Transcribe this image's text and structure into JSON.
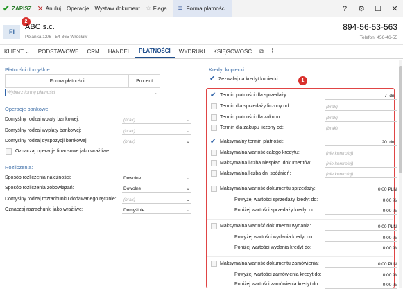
{
  "toolbar": {
    "save": "ZAPISZ",
    "cancel": "Anuluj",
    "operations": "Operacje",
    "issue_document": "Wystaw dokument",
    "flag": "Flaga",
    "active_tab": "Forma płatności",
    "icons": [
      "question-icon",
      "settings-icon",
      "maximize-icon",
      "close-icon"
    ]
  },
  "badges": {
    "one": "1",
    "two": "2"
  },
  "header": {
    "initials": "FI",
    "company": "ABC s.c.",
    "address": "Polanka 12/6 , 54-365 Wrocław",
    "nip": "894-56-53-563",
    "phone": "Telefon: 456-46-55"
  },
  "tabs": [
    "KLIENT ⌄",
    "PODSTAWOWE",
    "CRM",
    "HANDEL",
    "PŁATNOŚCI",
    "WYDRUKI",
    "KSIĘGOWOŚĆ"
  ],
  "left": {
    "payments_title": "Płatności domyślne:",
    "col_form": "Forma płatności",
    "col_percent": "Procent",
    "form_placeholder": "Wybierz formę płatności",
    "bank_title": "Operacje bankowe:",
    "bank_rows": [
      {
        "label": "Domyślny rodzaj wpłaty bankowej:",
        "value": "(brak)"
      },
      {
        "label": "Domyślny rodzaj wypłaty bankowej:",
        "value": "(brak)"
      },
      {
        "label": "Domyślny rodzaj dyspozycji bankowej:",
        "value": "(brak)"
      }
    ],
    "sensitive_label": "Oznaczaj operacje finansowe jako wrażliwe",
    "settle_title": "Rozliczenia:",
    "settle_rows": [
      {
        "label": "Sposób rozliczenia należności:",
        "value": "Dowolne"
      },
      {
        "label": "Sposób rozliczenia zobowiązań:",
        "value": "Dowolne"
      },
      {
        "label": "Domyślny rodzaj rozrachunku dodawanego ręcznie:",
        "value": "(brak)"
      },
      {
        "label": "Oznaczaj rozrachunki jako wrażliwe:",
        "value": "Domyślnie"
      }
    ]
  },
  "right": {
    "credit_title": "Kredyt kupiecki:",
    "allow_credit": "Zezwalaj na kredyt kupiecki",
    "rows": [
      {
        "label": "Termin płatności dla sprzedaży:",
        "value": "7",
        "unit": "dni",
        "checked": true
      },
      {
        "label": "Termin dla sprzedaży liczony od:",
        "value": "(brak)",
        "checked": false
      },
      {
        "label": "Termin płatności dla zakupu:",
        "value": "(brak)",
        "checked": false
      },
      {
        "label": "Termin dla zakupu liczony od:",
        "value": "(brak)",
        "checked": false
      },
      {
        "label": "Maksymalny termin płatności:",
        "value": "20",
        "unit": "dni",
        "checked": true
      },
      {
        "label": "Maksymalna wartość całego kredytu:",
        "value": "(nie kontroluj)",
        "checked": false
      },
      {
        "label": "Maksymalna liczba niespłac. dokumentów:",
        "value": "(nie kontroluj)",
        "checked": false
      },
      {
        "label": "Maksymalna liczba dni spóźnień:",
        "value": "(nie kontroluj)",
        "checked": false
      }
    ],
    "groups": [
      {
        "label": "Maksymalna wartość dokumentu sprzedaży:",
        "value": "0,00 PLN",
        "above": "Powyżej wartości sprzedaży kredyt do:",
        "above_val": "0,00 %",
        "below": "Poniżej wartości sprzedaży kredyt do:",
        "below_val": "0,00 %"
      },
      {
        "label": "Maksymalna wartość dokumentu wydania:",
        "value": "0,00 PLN",
        "above": "Powyżej wartości wydania kredyt do:",
        "above_val": "0,00 %",
        "below": "Poniżej wartości wydania kredyt do:",
        "below_val": "0,00 %"
      },
      {
        "label": "Maksymalna wartość dokumentu zamówienia:",
        "value": "0,00 PLN",
        "above": "Powyżej wartości zamówienia kredyt do:",
        "above_val": "0,00 %",
        "below": "Poniżej wartości zamówienia kredyt do:",
        "below_val": "0,00 %"
      }
    ]
  }
}
